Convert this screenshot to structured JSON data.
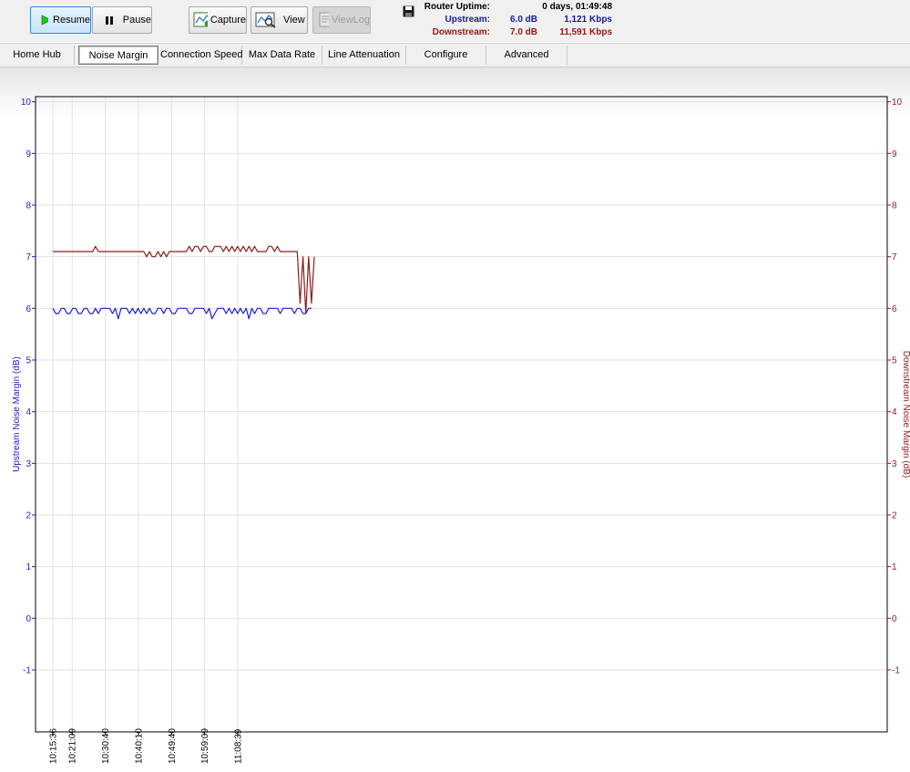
{
  "toolbar": {
    "resume": "Resume",
    "pause": "Pause",
    "capture": "Capture",
    "view": "View",
    "viewlog": "ViewLog"
  },
  "stats": {
    "uptime_label": "Router Uptime:",
    "uptime_value": "0 days, 01:49:48",
    "upstream_label": "Upstream:",
    "upstream_db": "6.0 dB",
    "upstream_rate": "1,121 Kbps",
    "downstream_label": "Downstream:",
    "downstream_db": "7.0 dB",
    "downstream_rate": "11,591 Kbps",
    "upstream_color": "#1a1a9c",
    "downstream_color": "#9c1414"
  },
  "tabs": [
    {
      "label": "Home Hub"
    },
    {
      "label": "Noise Margin",
      "selected": true
    },
    {
      "label": "Connection Speed"
    },
    {
      "label": "Max Data Rate"
    },
    {
      "label": "Line Attenuation"
    },
    {
      "label": "Configure"
    },
    {
      "label": "Advanced"
    }
  ],
  "chart_data": {
    "type": "line",
    "ylabel": "Upstream Noise Margin (dB)",
    "ylabel_right": "Downstream Noise Margin (dB)",
    "ylim": [
      -2.2,
      10.1
    ],
    "yticks": [
      10,
      9,
      8,
      7,
      6,
      5,
      4,
      3,
      2,
      1,
      0,
      -1
    ],
    "grid": true,
    "x_time_labels": [
      "10:15:36",
      "10:21:09",
      "10:30:40",
      "10:40:10",
      "10:49:40",
      "10:59:09",
      "11:08:39"
    ],
    "series": [
      {
        "name": "Upstream",
        "axis": "left",
        "color": "#1f1fd6",
        "values": [
          6.0,
          5.9,
          5.9,
          6.0,
          6.0,
          5.9,
          5.9,
          6.0,
          6.0,
          5.9,
          5.9,
          6.0,
          6.0,
          5.9,
          5.9,
          6.0,
          5.9,
          6.0,
          6.0,
          6.0,
          6.0,
          5.9,
          6.0,
          5.8,
          6.0,
          6.0,
          6.0,
          5.9,
          6.0,
          5.9,
          6.0,
          5.9,
          6.0,
          5.9,
          6.0,
          5.9,
          5.9,
          6.0,
          6.0,
          5.9,
          6.0,
          6.0,
          5.9,
          5.9,
          6.0,
          6.0,
          6.0,
          6.0,
          5.9,
          5.9,
          6.0,
          6.0,
          6.0,
          6.0,
          5.9,
          6.0,
          5.8,
          5.9,
          6.0,
          6.0,
          6.0,
          5.9,
          6.0,
          5.9,
          6.0,
          5.9,
          6.0,
          5.9,
          6.0,
          5.8,
          6.0,
          5.9,
          6.0,
          6.0,
          5.9,
          5.9,
          6.0,
          6.0,
          6.0,
          6.0,
          5.9,
          6.0,
          6.0,
          6.0,
          6.0,
          5.9,
          6.0,
          6.0,
          5.9,
          5.9,
          6.0,
          6.0
        ]
      },
      {
        "name": "Downstream",
        "axis": "right",
        "color": "#8e1b1b",
        "values": [
          7.1,
          7.1,
          7.1,
          7.1,
          7.1,
          7.1,
          7.1,
          7.1,
          7.1,
          7.1,
          7.1,
          7.1,
          7.1,
          7.1,
          7.1,
          7.2,
          7.1,
          7.1,
          7.1,
          7.1,
          7.1,
          7.1,
          7.1,
          7.1,
          7.1,
          7.1,
          7.1,
          7.1,
          7.1,
          7.1,
          7.1,
          7.1,
          7.1,
          7.0,
          7.1,
          7.0,
          7.0,
          7.1,
          7.0,
          7.1,
          7.0,
          7.1,
          7.1,
          7.1,
          7.1,
          7.1,
          7.1,
          7.1,
          7.2,
          7.1,
          7.2,
          7.2,
          7.1,
          7.2,
          7.2,
          7.1,
          7.1,
          7.2,
          7.2,
          7.2,
          7.1,
          7.2,
          7.1,
          7.2,
          7.1,
          7.2,
          7.1,
          7.2,
          7.1,
          7.2,
          7.1,
          7.2,
          7.1,
          7.1,
          7.1,
          7.1,
          7.2,
          7.2,
          7.1,
          7.2,
          7.1,
          7.1,
          7.1,
          7.1,
          7.1,
          7.1,
          7.1,
          6.1,
          7.0,
          5.9,
          7.0,
          6.1,
          7.0
        ]
      }
    ]
  }
}
